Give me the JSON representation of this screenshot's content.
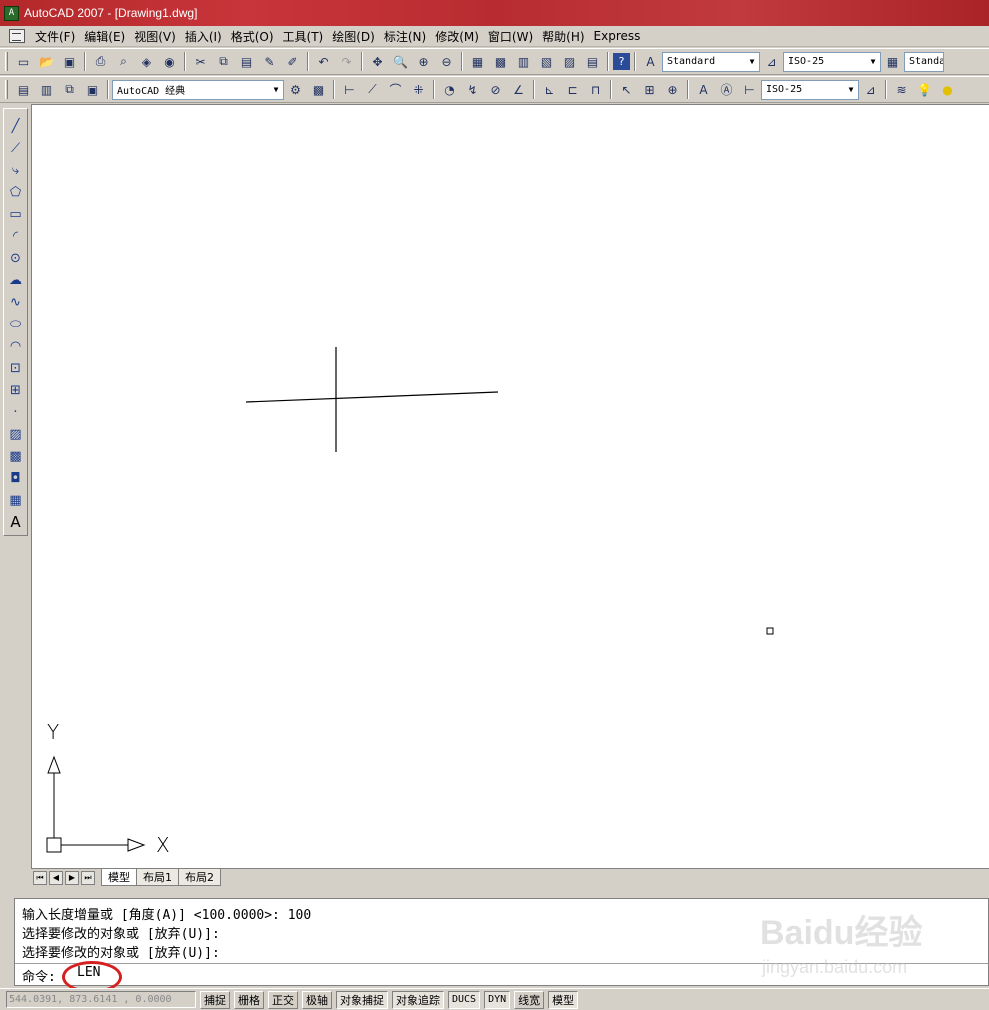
{
  "window": {
    "title": "AutoCAD 2007 - [Drawing1.dwg]",
    "app_icon": "autocad-logo-icon"
  },
  "menu": [
    "文件(F)",
    "编辑(E)",
    "视图(V)",
    "插入(I)",
    "格式(O)",
    "工具(T)",
    "绘图(D)",
    "标注(N)",
    "修改(M)",
    "窗口(W)",
    "帮助(H)",
    "Express"
  ],
  "toolbar1": {
    "text_style": "Standard",
    "dim_style": "ISO-25",
    "table_style": "Standa"
  },
  "toolbar2": {
    "workspace": "AutoCAD 经典",
    "dim_style": "ISO-25"
  },
  "draw_toolbar": {
    "text_tool": "A"
  },
  "ucs": {
    "x_label": "X",
    "y_label": "Y"
  },
  "layout_tabs": [
    "模型",
    "布局1",
    "布局2"
  ],
  "command": {
    "history": [
      "输入长度增量或 [角度(A)] <100.0000>: 100",
      "选择要修改的对象或 [放弃(U)]:",
      "选择要修改的对象或 [放弃(U)]:"
    ],
    "prompt": "命令:",
    "input": "LEN"
  },
  "status": {
    "coordinates": "544.0391,  873.6141 , 0.0000",
    "buttons": [
      "捕捉",
      "栅格",
      "正交",
      "极轴",
      "对象捕捉",
      "对象追踪",
      "DUCS",
      "DYN",
      "线宽",
      "模型"
    ]
  },
  "watermark": {
    "main": "Baidu经验",
    "sub": "jingyan.baidu.com"
  }
}
